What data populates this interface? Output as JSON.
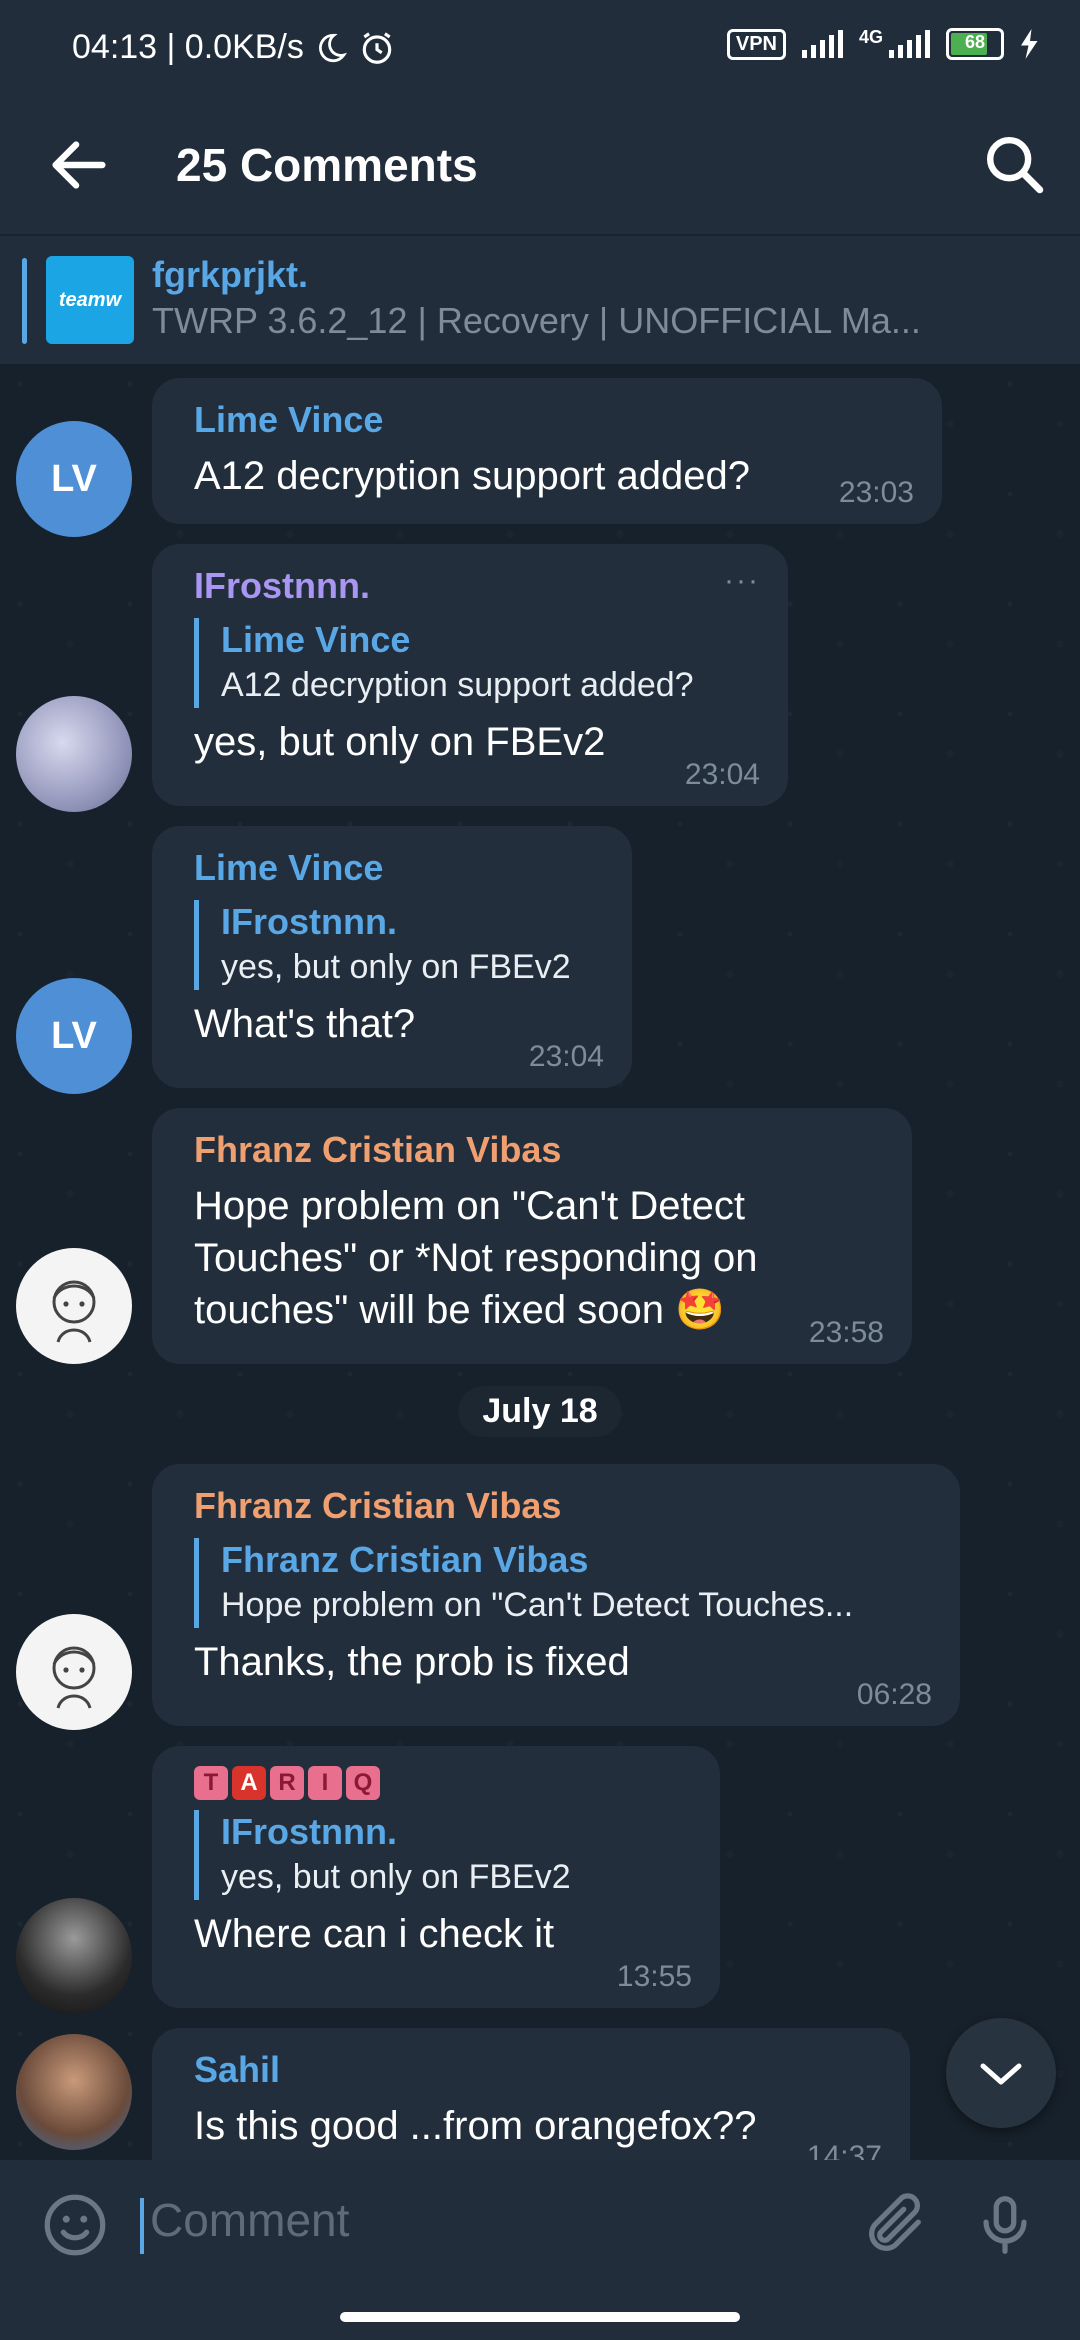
{
  "status_bar": {
    "time_speed": "04:13 | 0.0KB/s",
    "vpn": "VPN",
    "network": "4G",
    "battery": "68"
  },
  "header": {
    "title": "25 Comments"
  },
  "channel": {
    "thumb_text": "teamw",
    "name": "fgrkprjkt.",
    "description": "TWRP 3.6.2_12 | Recovery | UNOFFICIAL  Ma..."
  },
  "messages": [
    {
      "avatar": "LV",
      "author": "Lime Vince",
      "author_color": "#5aa7e6",
      "text": "A12 decryption support added?",
      "time": "23:03"
    },
    {
      "author": "IFrostnnn.",
      "author_color": "#a996f2",
      "reply_author": "Lime Vince",
      "reply_text": "A12 decryption support added?",
      "text": "yes, but only on FBEv2",
      "time": "23:04"
    },
    {
      "avatar": "LV",
      "author": "Lime Vince",
      "author_color": "#5aa7e6",
      "reply_author": "IFrostnnn.",
      "reply_text": "yes, but only on FBEv2",
      "text": "What's that?",
      "time": "23:04"
    },
    {
      "author": "Fhranz Cristian Vibas",
      "author_color": "#f0a070",
      "text": "Hope problem on \"Can't Detect Touches\" or *Not responding on touches\" will be fixed soon 🤩",
      "time": "23:58"
    },
    {
      "author": "Fhranz Cristian Vibas",
      "author_color": "#f0a070",
      "reply_author": "Fhranz Cristian Vibas",
      "reply_text": "Hope problem on \"Can't Detect Touches...",
      "text": "Thanks, the prob is fixed",
      "time": "06:28"
    },
    {
      "tags": [
        "T",
        "A",
        "R",
        "I",
        "Q"
      ],
      "reply_author": "IFrostnnn.",
      "reply_text": "yes, but only on FBEv2",
      "text": "Where can i check it",
      "time": "13:55"
    },
    {
      "author": "Sahil",
      "author_color": "#5aa7e6",
      "text": "Is this good ...from orangefox??",
      "time": "14:37"
    }
  ],
  "date_divider": "July 18",
  "input": {
    "placeholder": "Comment"
  },
  "colors": {
    "accent": "#5aa7e6",
    "background": "#17212b",
    "bubble": "#222e3b",
    "bar": "#212d3b"
  }
}
